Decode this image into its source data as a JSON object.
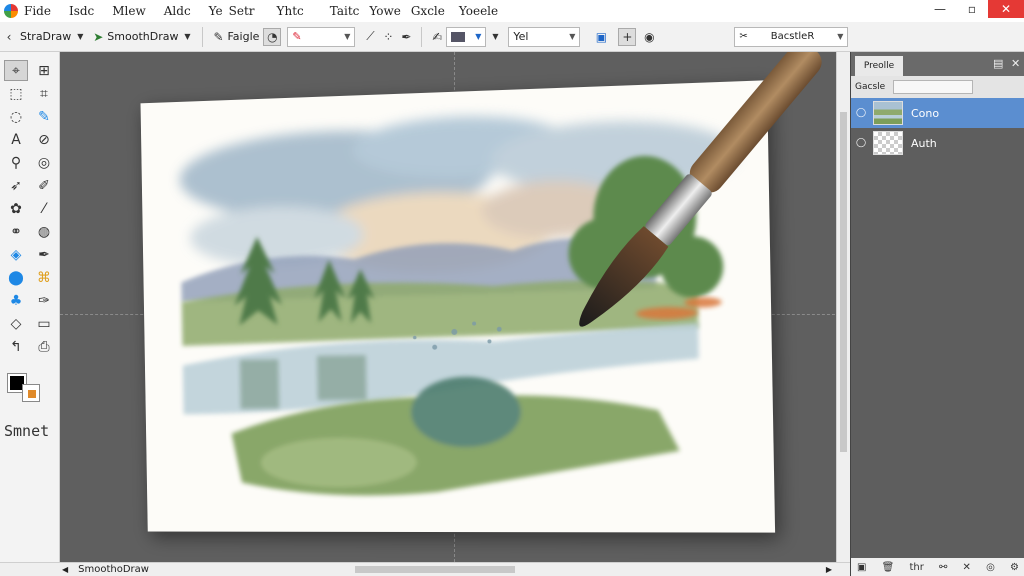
{
  "menubar": {
    "items": [
      "Fide",
      "Isdc",
      "Mlew",
      "Aldc",
      "Ye",
      "Setr",
      "Yhtc",
      "Taitc",
      "Yowe",
      "Gxcle",
      "Yoeele"
    ],
    "window": {
      "minimize": "—",
      "maximize": "▫",
      "close": "✕"
    }
  },
  "toolbar": {
    "brush_preset": "StraDraw",
    "tool_name": "SmoothDraw",
    "brush_mode": "Faigle",
    "size_field": "Yel",
    "layer_select": "BacstleR"
  },
  "tools": {
    "icons": [
      "pointer-icon",
      "grid-move-icon",
      "marquee-icon",
      "crop-icon",
      "lasso-icon",
      "pen-icon",
      "text-icon",
      "smudge-icon",
      "zoom-icon",
      "dodge-icon",
      "brush-icon",
      "pencil-icon",
      "blob-icon",
      "line-icon",
      "airbrush-icon",
      "eraser-icon",
      "eyedropper-icon",
      "inkpen-icon",
      "bucket-icon",
      "crayon-icon",
      "smear-icon",
      "marker-icon",
      "fill-icon",
      "clone-icon",
      "hand-icon",
      "rotate-icon"
    ],
    "brush_label": "Smnet",
    "fg_color": "#000000",
    "bg_color": "#ffffff",
    "accent_color": "#e08a2a"
  },
  "status": {
    "label": "SmoothoDraw"
  },
  "panel": {
    "tab": "Preolle",
    "blend_label": "Gacsle",
    "layers": [
      {
        "name": "Cono",
        "selected": true
      },
      {
        "name": "Auth",
        "selected": false
      }
    ],
    "footer_label": "thr"
  },
  "colors": {
    "canvas_bg": "#5f5f5f",
    "panel_bg": "#5e5e5e",
    "selection": "#5b8ed0",
    "close_btn": "#e53935"
  }
}
